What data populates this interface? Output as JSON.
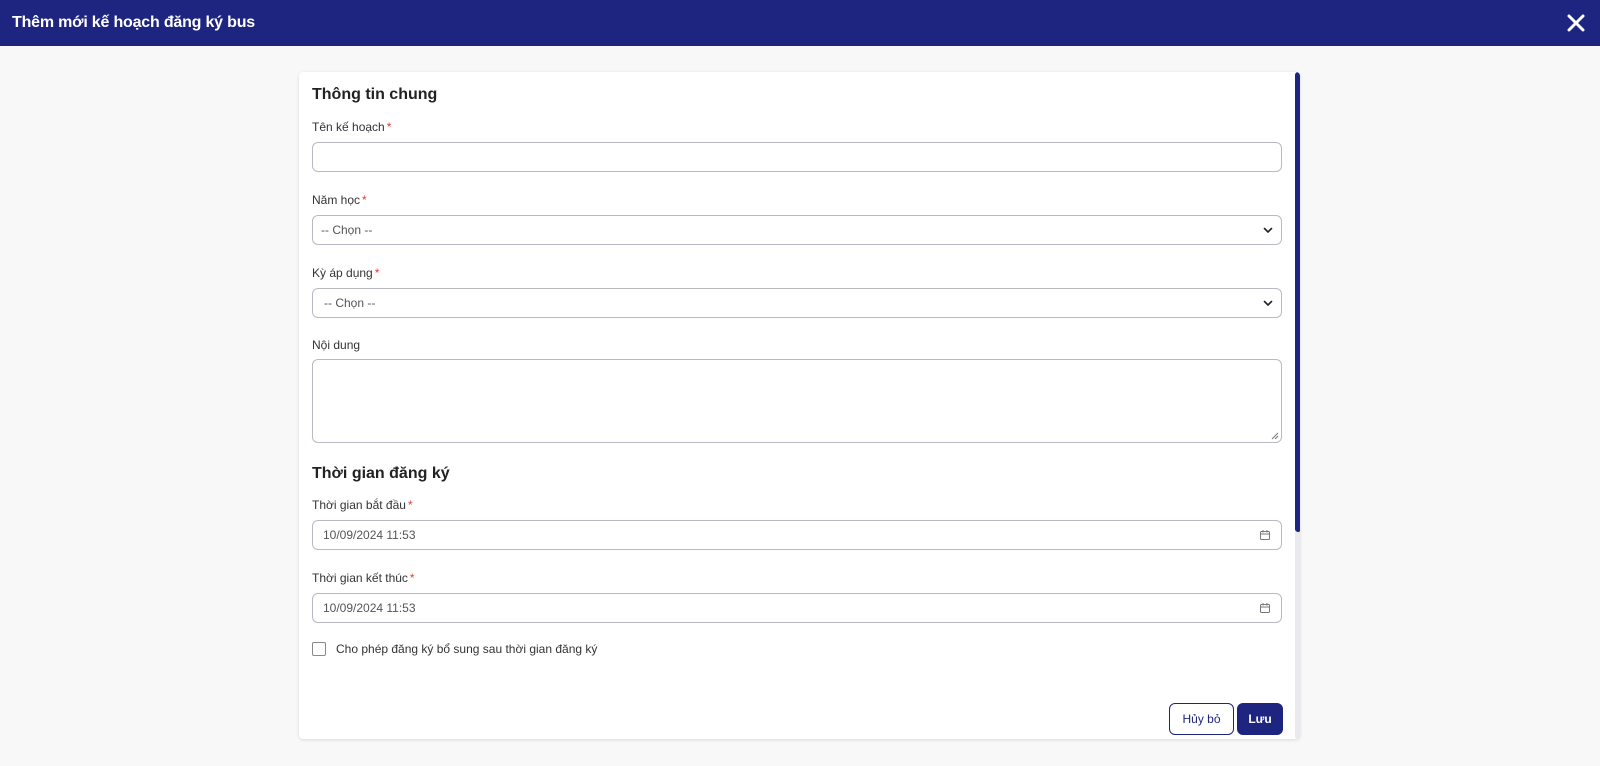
{
  "header": {
    "title": "Thêm mới kế hoạch đăng ký bus"
  },
  "form": {
    "section_general": "Thông tin chung",
    "plan_name": {
      "label": "Tên kế hoạch",
      "required_mark": "*",
      "value": ""
    },
    "school_year": {
      "label": "Năm học",
      "required_mark": "*",
      "selected": "-- Chọn --"
    },
    "term": {
      "label": "Kỳ áp dụng",
      "required_mark": "*",
      "selected": "-- Chọn --"
    },
    "content": {
      "label": "Nội dung",
      "value": ""
    },
    "section_time": "Thời gian đăng ký",
    "start_time": {
      "label": "Thời gian bắt đầu",
      "required_mark": "*",
      "value": "10/09/2024 11:53"
    },
    "end_time": {
      "label": "Thời gian kết thúc",
      "required_mark": "*",
      "value": "10/09/2024 11:53"
    },
    "allow_late": {
      "label": "Cho phép đăng ký bổ sung sau thời gian đăng ký",
      "checked": false
    }
  },
  "actions": {
    "cancel_label": "Hủy bỏ",
    "save_label": "Lưu"
  },
  "colors": {
    "primary": "#1d2580",
    "required": "#e53935",
    "border": "#b9b9c6"
  },
  "icons": {
    "close": "close-icon",
    "chevron": "chevron-down-icon",
    "calendar": "calendar-icon"
  }
}
